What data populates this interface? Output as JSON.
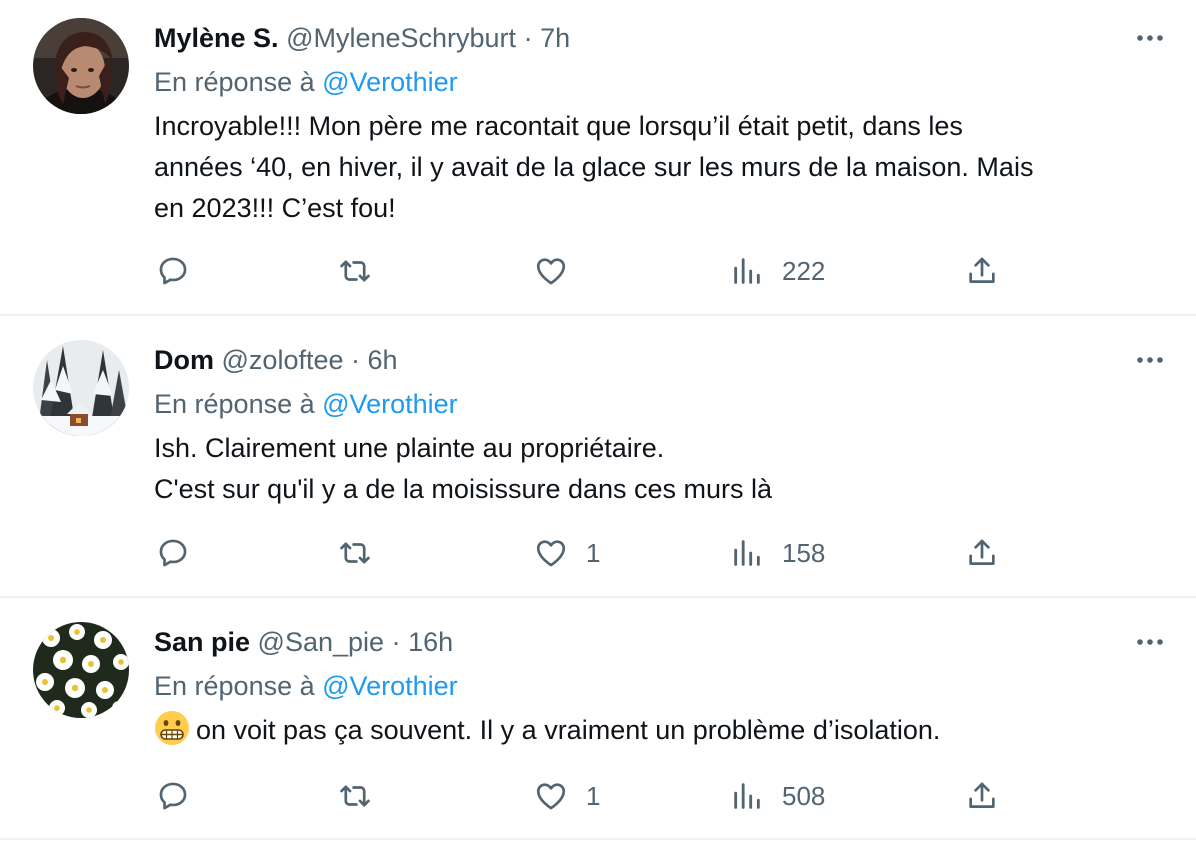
{
  "replies": [
    {
      "name": "Mylène S.",
      "handle": "@MyleneSchryburt",
      "separator": "·",
      "time": "7h",
      "reply_prefix": "En réponse à",
      "reply_mention": "@Verothier",
      "text_lines": [
        "Incroyable!!! Mon père me racontait que lorsqu’il était petit, dans les",
        "années ‘40, en hiver, il y avait de la glace sur les murs de la maison. Mais",
        "en 2023!!! C’est fou!"
      ],
      "emoji": "",
      "stats": {
        "replies": "",
        "retweets": "",
        "likes": "",
        "views": "222"
      },
      "avatar": "portrait-photo"
    },
    {
      "name": "Dom",
      "handle": "@zoloftee",
      "separator": "·",
      "time": "6h",
      "reply_prefix": "En réponse à",
      "reply_mention": "@Verothier",
      "text_lines": [
        "Ish. Clairement une plainte au propriétaire.",
        "C'est sur qu'il y a de la moisissure dans ces murs là"
      ],
      "emoji": "",
      "stats": {
        "replies": "",
        "retweets": "",
        "likes": "1",
        "views": "158"
      },
      "avatar": "snowy-cabin-photo"
    },
    {
      "name": "San pie",
      "handle": "@San_pie",
      "separator": "·",
      "time": "16h",
      "reply_prefix": "En réponse à",
      "reply_mention": "@Verothier",
      "text_lines": [
        "on voit pas ça souvent. Il y a vraiment un problème d’isolation."
      ],
      "emoji": "grimacing-face-emoji",
      "stats": {
        "replies": "",
        "retweets": "",
        "likes": "1",
        "views": "508"
      },
      "avatar": "daisies-photo"
    }
  ],
  "icons": {
    "reply": "reply-icon",
    "retweet": "retweet-icon",
    "like": "heart-icon",
    "views": "views-icon",
    "share": "share-icon",
    "more": "more-icon"
  },
  "colors": {
    "text": "#0f1419",
    "secondary": "#536471",
    "link": "#1d9bf0",
    "divider": "#eff3f4"
  }
}
